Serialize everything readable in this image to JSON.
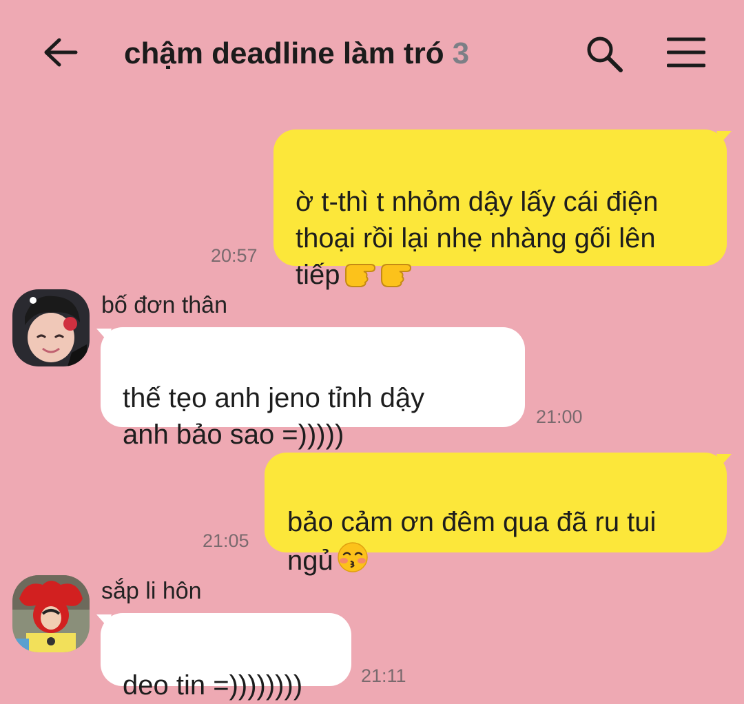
{
  "header": {
    "title": "chậm deadline làm tró",
    "member_count": "3",
    "back_icon": "arrow-left-icon",
    "search_icon": "search-icon",
    "menu_icon": "hamburger-menu-icon"
  },
  "colors": {
    "background": "#EEA9B3",
    "my_bubble": "#FCE73A",
    "their_bubble": "#FFFFFF",
    "member_count": "#7c7f86"
  },
  "messages": [
    {
      "from": "me",
      "text": "ờ t-thì t nhỏm dậy lấy cái điện\nthoại rồi lại nhẹ nhàng gối lên\ntiếp",
      "emoji": "backhand-index-pointing-right-icon x2",
      "time": "20:57"
    },
    {
      "from": "them",
      "sender": "bố đơn thân",
      "text": "thế tẹo anh jeno tỉnh dậy\nanh bảo sao =)))))",
      "time": "21:00"
    },
    {
      "from": "me",
      "text": "bảo cảm ơn đêm qua đã ru tui\nngủ",
      "emoji": "kissing-face-with-smiling-eyes-icon",
      "time": "21:05"
    },
    {
      "from": "them",
      "sender": "sắp li hôn",
      "text": "deo tin =))))))))",
      "time": "21:11"
    }
  ]
}
